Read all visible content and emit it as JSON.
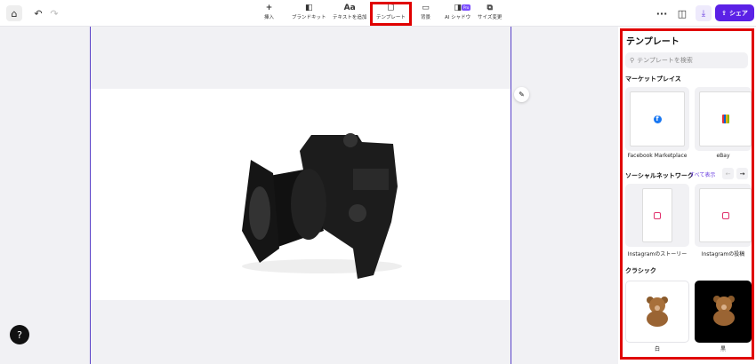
{
  "toolbar": {
    "tools": [
      {
        "label": "挿入",
        "icon": "plus-icon",
        "glyph": "+"
      },
      {
        "label": "ブランドキット",
        "icon": "brand-kit-icon",
        "glyph": "◧"
      },
      {
        "label": "テキストを追加",
        "icon": "text-icon",
        "glyph": "Aa"
      },
      {
        "label": "テンプレート",
        "icon": "template-icon",
        "glyph": "🗋"
      },
      {
        "label": "背景",
        "icon": "background-icon",
        "glyph": "▭"
      },
      {
        "label": "AI シャドウ",
        "icon": "ai-shadow-icon",
        "glyph": "◨"
      },
      {
        "label": "サイズ変更",
        "icon": "resize-icon",
        "glyph": "⧉"
      }
    ],
    "pro_badge": "Pro",
    "share_label": "シェア",
    "more": "···"
  },
  "panel": {
    "title": "テンプレート",
    "search_placeholder": "テンプレートを検索",
    "sections": {
      "marketplace": {
        "title": "マーケットプレイス",
        "items": [
          "Facebook Marketplace",
          "eBay"
        ]
      },
      "social": {
        "title": "ソーシャルネットワーク",
        "see_all": "すべて表示",
        "items": [
          "Instagramのストーリー",
          "Instagramの投稿"
        ]
      },
      "classic": {
        "title": "クラシック",
        "items": [
          "白",
          "黒"
        ]
      }
    }
  },
  "colors": {
    "accent": "#5b21e6",
    "highlight": "#e00000"
  }
}
